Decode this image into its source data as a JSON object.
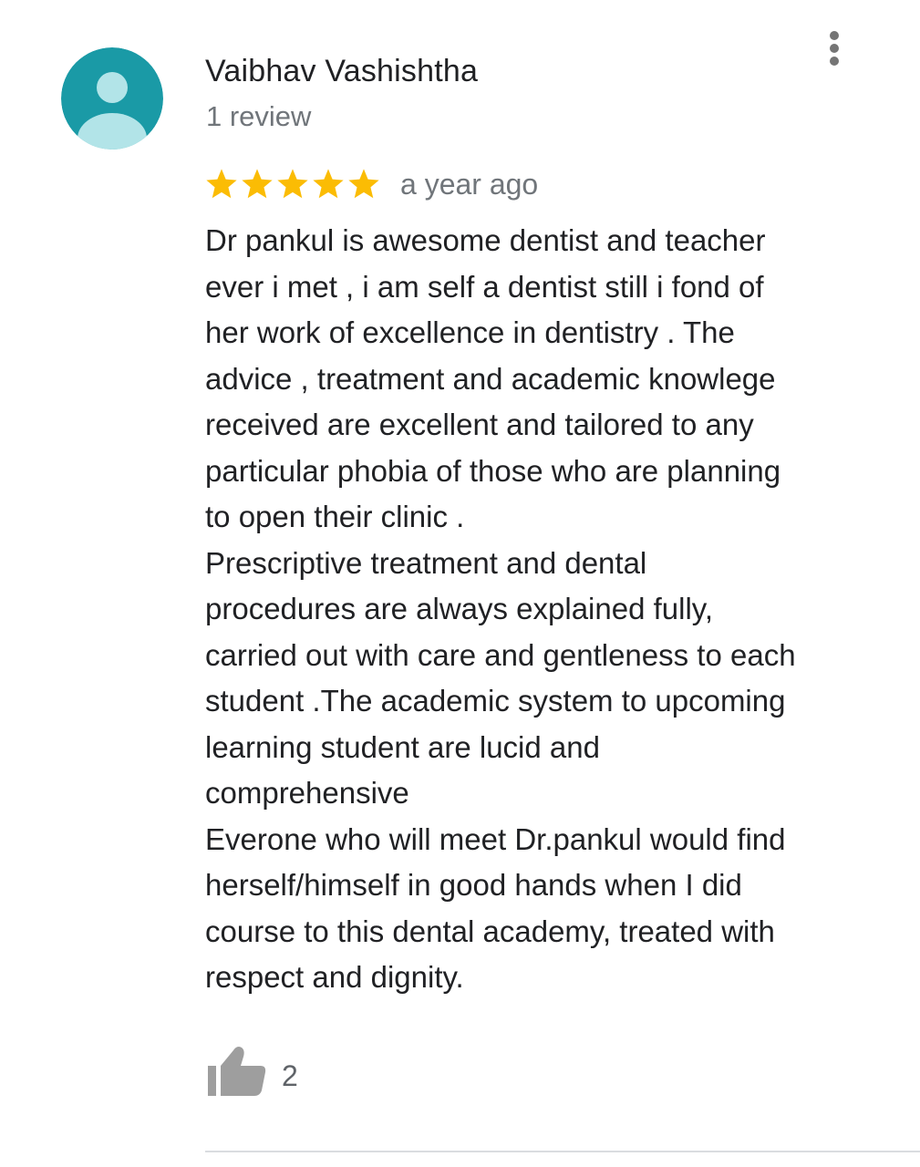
{
  "colors": {
    "avatar_bg": "#1a9aa6",
    "avatar_figure": "#b2e4e8",
    "star": "#fbbc04",
    "text_primary": "#202124",
    "text_secondary": "#70757a",
    "icon_gray": "#9e9e9e",
    "divider": "#dadce0"
  },
  "review": {
    "reviewer_name": "Vaibhav Vashishtha",
    "review_count": "1 review",
    "rating": 5,
    "rating_max": 5,
    "time": "a year ago",
    "text_lines": [
      "Dr pankul is awesome dentist and teacher",
      "ever i met , i am self a dentist still i fond of",
      "her work of excellence in dentistry . The",
      "advice , treatment and academic knowlege",
      "received are excellent and tailored to any",
      "particular phobia of those who are planning",
      "to open their clinic .",
      "Prescriptive treatment and dental",
      "procedures are always explained fully,",
      "carried out with care and gentleness to each",
      "student .The academic system to upcoming",
      "learning student are lucid and",
      "comprehensive",
      "Everone who will meet Dr.pankul would find",
      "herself/himself in good hands when I did",
      "course to this dental academy, treated with",
      "respect and dignity."
    ],
    "like_count": "2"
  },
  "icons": {
    "avatar": "default-avatar-icon",
    "menu": "more-vertical-icon",
    "rating": "star-icon",
    "like": "thumbs-up-icon"
  }
}
